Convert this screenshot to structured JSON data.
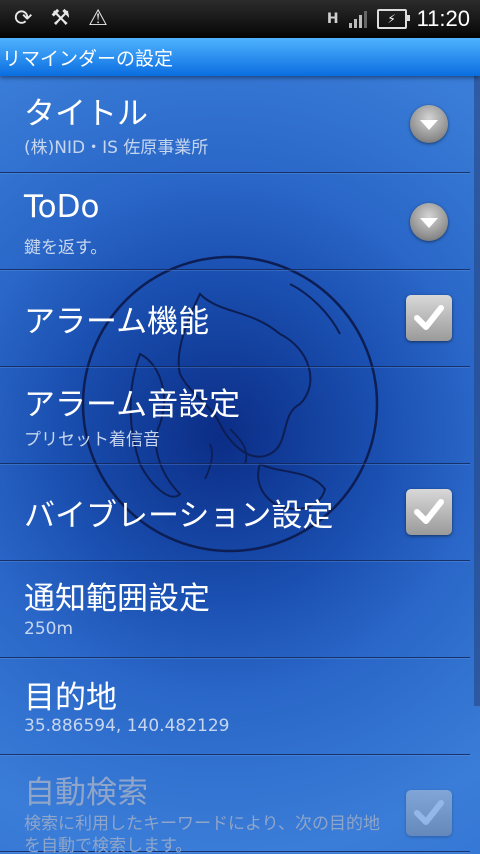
{
  "status_bar": {
    "icons": [
      "sync-icon",
      "usb-debug-icon",
      "warning-icon"
    ],
    "network_type": "H",
    "time": "11:20"
  },
  "header": {
    "title": "リマインダーの設定"
  },
  "settings": [
    {
      "title": "タイトル",
      "summary": "(株)NID・IS 佐原事業所",
      "control": "dropdown"
    },
    {
      "title": "ToDo",
      "summary": "鍵を返す。",
      "control": "dropdown"
    },
    {
      "title": "アラーム機能",
      "summary": "",
      "control": "checkbox",
      "checked": true
    },
    {
      "title": "アラーム音設定",
      "summary": "プリセット着信音",
      "control": "none"
    },
    {
      "title": "バイブレーション設定",
      "summary": "",
      "control": "checkbox",
      "checked": true
    },
    {
      "title": "通知範囲設定",
      "summary": "250m",
      "control": "none"
    },
    {
      "title": "目的地",
      "summary": "35.886594, 140.482129",
      "control": "none"
    },
    {
      "title": "自動検索",
      "summary": "検索に利用したキーワードにより、次の目的地を自動で検索します。",
      "control": "checkbox",
      "checked": true,
      "disabled": true
    }
  ]
}
